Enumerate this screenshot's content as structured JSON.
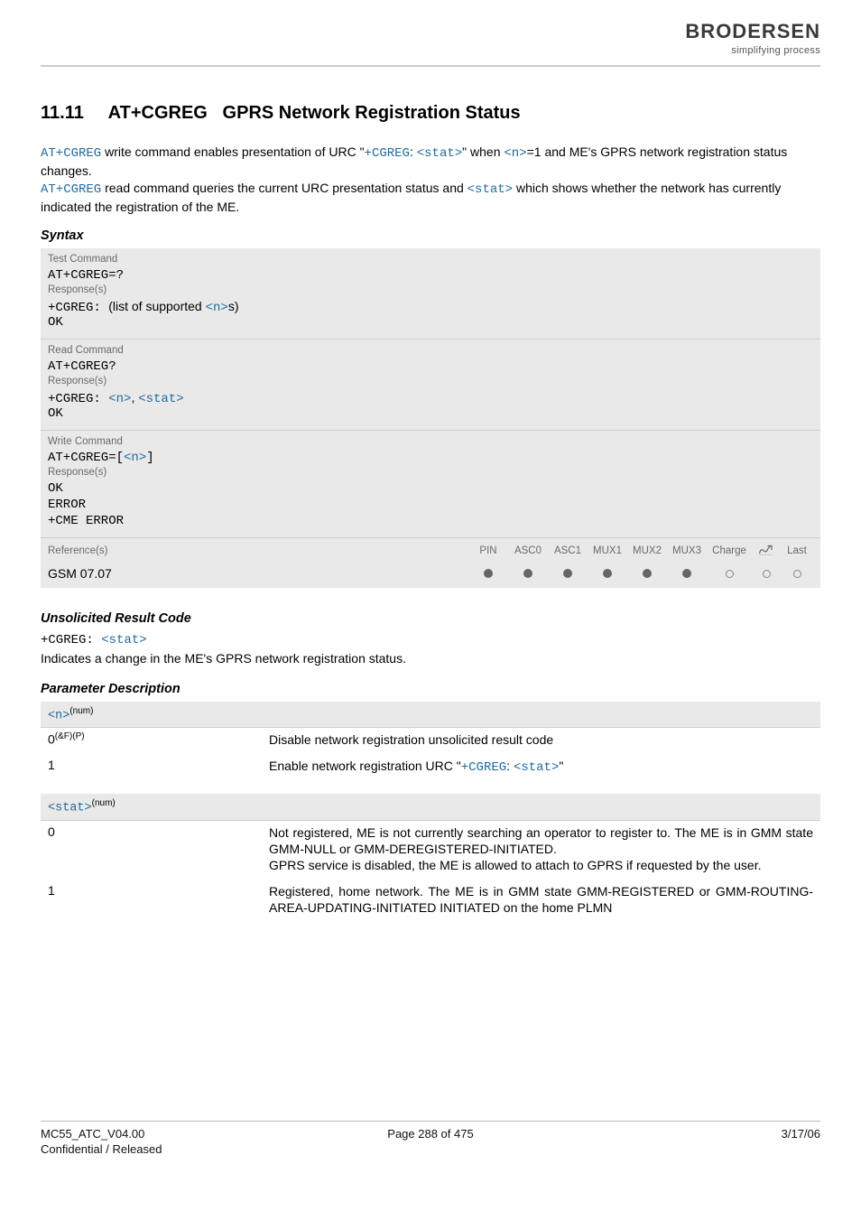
{
  "logo": {
    "brand": "BRODERSEN",
    "tagline": "simplifying process"
  },
  "section": {
    "number": "11.11",
    "cmd": "AT+CGREG",
    "title": "GPRS Network Registration Status"
  },
  "intro": {
    "part1_cmd": "AT+CGREG",
    "part1_text": " write command enables presentation of URC \"",
    "part1_urc": "+CGREG",
    "part1_sep": ": ",
    "part1_param": "<stat>",
    "part1_text2": "\" when ",
    "part1_n": "<n>",
    "part1_text3": "=1 and ME's GPRS network registration status changes.",
    "part2_cmd": "AT+CGREG",
    "part2_text": " read command queries the current URC presentation status and ",
    "part2_param": "<stat>",
    "part2_text2": " which shows whether the network has currently indicated the registration of the ME."
  },
  "headings": {
    "syntax": "Syntax",
    "urc": "Unsolicited Result Code",
    "params": "Parameter Description"
  },
  "syntax": {
    "test": {
      "label": "Test Command",
      "cmd": "AT+CGREG=?",
      "resp_label": "Response(s)",
      "resp_prefix": "+CGREG: ",
      "resp_text1": "(list of supported ",
      "resp_param": "<n>",
      "resp_text2": "s)",
      "ok": "OK"
    },
    "read": {
      "label": "Read Command",
      "cmd": "AT+CGREG?",
      "resp_label": "Response(s)",
      "resp_prefix": "+CGREG: ",
      "resp_p1": "<n>",
      "resp_sep": ", ",
      "resp_p2": "<stat>",
      "ok": "OK"
    },
    "write": {
      "label": "Write Command",
      "cmd_prefix": "AT+CGREG=",
      "cmd_br_open": "[",
      "cmd_param": "<n>",
      "cmd_br_close": "]",
      "resp_label": "Response(s)",
      "ok": "OK",
      "error": "ERROR",
      "cme": "+CME ERROR"
    },
    "ref": {
      "label": "Reference(s)",
      "cols": [
        "PIN",
        "ASC0",
        "ASC1",
        "MUX1",
        "MUX2",
        "MUX3",
        "Charge",
        "",
        "Last"
      ],
      "value": "GSM 07.07",
      "dots": [
        "filled",
        "filled",
        "filled",
        "filled",
        "filled",
        "filled",
        "open",
        "open",
        "open"
      ]
    }
  },
  "urc": {
    "prefix": "+CGREG: ",
    "param": "<stat>",
    "text": "Indicates a change in the ME's GPRS network registration status."
  },
  "params": {
    "n": {
      "name": "<n>",
      "type": "(num)",
      "rows": [
        {
          "key_val": "0",
          "key_sup": "(&F)(P)",
          "desc": "Disable network registration unsolicited result code"
        },
        {
          "key_val": "1",
          "key_sup": "",
          "desc_pre": "Enable network registration URC \"",
          "desc_cmd": "+CGREG",
          "desc_sep": ": ",
          "desc_param": "<stat>",
          "desc_post": "\""
        }
      ]
    },
    "stat": {
      "name": "<stat>",
      "type": "(num)",
      "rows": [
        {
          "key_val": "0",
          "desc": "Not registered, ME is not currently searching an operator to register to. The ME is in GMM state GMM-NULL or GMM-DEREGISTERED-INITIATED.\nGPRS service is disabled, the ME is allowed to attach to GPRS if requested by the user."
        },
        {
          "key_val": "1",
          "desc": "Registered, home network. The ME is in GMM state GMM-REGISTERED or GMM-ROUTING-AREA-UPDATING-INITIATED INITIATED on the home PLMN"
        }
      ]
    }
  },
  "footer": {
    "left1": "MC55_ATC_V04.00",
    "center": "Page 288 of 475",
    "right": "3/17/06",
    "left2": "Confidential / Released"
  }
}
